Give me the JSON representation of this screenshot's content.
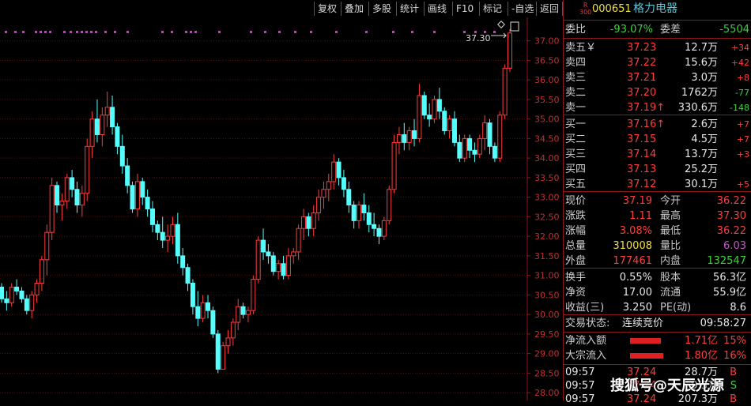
{
  "toolbar": {
    "buttons": [
      "复权",
      "叠加",
      "多股",
      "统计",
      "画线",
      "F10",
      "标记",
      "-自选",
      "返回"
    ]
  },
  "stock": {
    "badge_top": "R",
    "badge_bottom": "300",
    "code": "000651",
    "name": "格力电器"
  },
  "weibi": {
    "label1": "委比",
    "value1": "-93.07%",
    "label2": "委差",
    "value2": "-5504"
  },
  "sell": [
    {
      "label": "卖五￥",
      "price": "37.23",
      "vol": "12.7万",
      "chg": "+34"
    },
    {
      "label": "卖四",
      "price": "37.22",
      "vol": "15.6万",
      "chg": "+42"
    },
    {
      "label": "卖三",
      "price": "37.21",
      "vol": "3.0万",
      "chg": "+8"
    },
    {
      "label": "卖二",
      "price": "37.20",
      "vol": "1762万",
      "chg": "-77"
    },
    {
      "label": "卖一",
      "price": "37.19↑",
      "vol": "330.6万",
      "chg": "-148"
    }
  ],
  "buy": [
    {
      "label": "买一",
      "price": "37.16↑",
      "vol": "2.6万",
      "chg": "+7"
    },
    {
      "label": "买二",
      "price": "37.15",
      "vol": "4.5万",
      "chg": "+7"
    },
    {
      "label": "买三",
      "price": "37.14",
      "vol": "13.7万",
      "chg": "+3"
    },
    {
      "label": "买四",
      "price": "37.13",
      "vol": "25.2万",
      "chg": ""
    },
    {
      "label": "买五",
      "price": "37.12",
      "vol": "30.1万",
      "chg": "+5"
    }
  ],
  "quote": [
    {
      "l1": "现价",
      "v1": "37.19",
      "l2": "今开",
      "v2": "36.22"
    },
    {
      "l1": "涨跌",
      "v1": "1.11",
      "l2": "最高",
      "v2": "37.30"
    },
    {
      "l1": "涨幅",
      "v1": "3.08%",
      "l2": "最低",
      "v2": "36.22"
    },
    {
      "l1": "总量",
      "v1": "310008",
      "l2": "量比",
      "v2": "6.03"
    },
    {
      "l1": "外盘",
      "v1": "177461",
      "l2": "内盘",
      "v2": "132547"
    }
  ],
  "fund": [
    {
      "l1": "换手",
      "v1": "0.55%",
      "l2": "股本",
      "v2": "56.3亿"
    },
    {
      "l1": "净资",
      "v1": "17.00",
      "l2": "流通",
      "v2": "55.9亿"
    },
    {
      "l1": "收益(三)",
      "v1": "3.250",
      "l2": "PE(动)",
      "v2": "8.6"
    }
  ],
  "status": {
    "label": "交易状态:",
    "value": "连续竞价",
    "time": "09:58:27"
  },
  "flow": [
    {
      "label": "净流入额",
      "amount": "1.71亿",
      "pct": "15%",
      "bar": 0.15
    },
    {
      "label": "大宗流入",
      "amount": "1.80亿",
      "pct": "16%",
      "bar": 0.16
    }
  ],
  "ticks": [
    {
      "time": "09:57",
      "price": "37.24",
      "vol": "28.7万",
      "side": "B"
    },
    {
      "time": "09:57",
      "price": "37.24",
      "vol": "9.3万",
      "side": "S"
    },
    {
      "time": "09:57",
      "price": "37.24",
      "vol": "207.3万",
      "side": "B"
    }
  ],
  "annotation": {
    "price_label": "37.30"
  },
  "watermark": "搜狐号@天辰光源",
  "chart_data": {
    "type": "candlestick",
    "ylim": [
      27.8,
      37.6
    ],
    "yticks": [
      "37.00",
      "36.50",
      "36.00",
      "35.50",
      "35.00",
      "34.50",
      "34.00",
      "33.50",
      "33.00",
      "32.50",
      "32.00",
      "31.50",
      "31.00",
      "30.50",
      "30.00",
      "29.50",
      "29.00",
      "28.50",
      "28.00"
    ],
    "colors": {
      "up": "#ff3c3c",
      "down": "#54ffff"
    },
    "candles": [
      [
        30.7,
        30.8,
        30.3,
        30.4
      ],
      [
        30.4,
        30.6,
        30.1,
        30.3
      ],
      [
        30.3,
        30.8,
        30.2,
        30.7
      ],
      [
        30.7,
        30.9,
        30.5,
        30.6
      ],
      [
        30.6,
        30.7,
        30.3,
        30.4
      ],
      [
        30.4,
        30.5,
        30.0,
        30.1
      ],
      [
        30.1,
        30.6,
        29.9,
        30.5
      ],
      [
        30.5,
        30.9,
        30.3,
        30.8
      ],
      [
        30.8,
        31.5,
        30.6,
        31.4
      ],
      [
        31.4,
        32.3,
        31.0,
        32.1
      ],
      [
        32.1,
        33.5,
        31.9,
        33.3
      ],
      [
        33.3,
        33.4,
        32.6,
        32.8
      ],
      [
        32.8,
        33.1,
        32.4,
        32.9
      ],
      [
        32.9,
        33.6,
        32.7,
        33.5
      ],
      [
        33.5,
        33.7,
        33.0,
        33.2
      ],
      [
        33.2,
        33.4,
        32.6,
        32.8
      ],
      [
        32.8,
        33.3,
        32.5,
        33.1
      ],
      [
        33.1,
        34.5,
        32.9,
        34.3
      ],
      [
        34.3,
        35.2,
        34.0,
        35.0
      ],
      [
        35.0,
        35.5,
        34.4,
        34.6
      ],
      [
        34.6,
        35.3,
        34.3,
        35.1
      ],
      [
        35.1,
        35.7,
        34.8,
        35.3
      ],
      [
        35.3,
        35.6,
        34.6,
        34.8
      ],
      [
        34.8,
        34.9,
        34.1,
        34.3
      ],
      [
        34.3,
        34.6,
        33.6,
        33.8
      ],
      [
        33.8,
        34.0,
        33.1,
        33.3
      ],
      [
        33.3,
        33.4,
        32.6,
        32.7
      ],
      [
        32.7,
        33.6,
        32.5,
        33.4
      ],
      [
        33.4,
        33.5,
        32.8,
        33.0
      ],
      [
        33.0,
        33.2,
        32.5,
        32.7
      ],
      [
        32.7,
        32.9,
        32.1,
        32.3
      ],
      [
        32.3,
        32.4,
        31.9,
        32.1
      ],
      [
        32.1,
        32.5,
        31.7,
        31.9
      ],
      [
        31.9,
        32.3,
        31.6,
        32.0
      ],
      [
        32.0,
        32.5,
        31.8,
        32.3
      ],
      [
        32.3,
        32.6,
        31.3,
        31.5
      ],
      [
        31.5,
        31.7,
        31.0,
        31.2
      ],
      [
        31.2,
        31.3,
        30.6,
        30.8
      ],
      [
        30.8,
        30.9,
        30.0,
        30.2
      ],
      [
        30.2,
        30.6,
        29.7,
        29.9
      ],
      [
        29.9,
        30.5,
        29.8,
        30.3
      ],
      [
        30.3,
        30.5,
        29.9,
        30.1
      ],
      [
        30.1,
        30.2,
        29.4,
        29.5
      ],
      [
        29.5,
        29.6,
        28.5,
        28.6
      ],
      [
        28.6,
        29.3,
        28.6,
        29.2
      ],
      [
        29.2,
        29.6,
        29.0,
        29.4
      ],
      [
        29.4,
        29.9,
        29.2,
        29.8
      ],
      [
        29.8,
        30.4,
        29.6,
        30.2
      ],
      [
        30.2,
        30.3,
        29.9,
        30.0
      ],
      [
        30.0,
        30.2,
        29.8,
        30.1
      ],
      [
        30.1,
        31.0,
        30.0,
        30.9
      ],
      [
        30.9,
        32.0,
        30.8,
        31.9
      ],
      [
        31.9,
        32.2,
        31.4,
        31.6
      ],
      [
        31.6,
        31.8,
        31.3,
        31.5
      ],
      [
        31.5,
        31.6,
        31.0,
        31.1
      ],
      [
        31.1,
        31.4,
        30.9,
        31.3
      ],
      [
        31.3,
        31.5,
        30.9,
        31.0
      ],
      [
        31.0,
        31.7,
        30.9,
        31.5
      ],
      [
        31.5,
        31.7,
        31.3,
        31.6
      ],
      [
        31.6,
        32.3,
        31.4,
        32.2
      ],
      [
        32.2,
        32.7,
        31.9,
        32.5
      ],
      [
        32.5,
        32.6,
        32.0,
        32.2
      ],
      [
        32.2,
        32.8,
        32.0,
        32.6
      ],
      [
        32.6,
        33.2,
        32.4,
        33.0
      ],
      [
        33.0,
        33.4,
        32.7,
        33.2
      ],
      [
        33.2,
        33.6,
        32.9,
        33.4
      ],
      [
        33.4,
        34.1,
        33.2,
        33.9
      ],
      [
        33.9,
        34.0,
        33.3,
        33.5
      ],
      [
        33.5,
        33.7,
        33.0,
        33.2
      ],
      [
        33.2,
        33.4,
        32.6,
        32.8
      ],
      [
        32.8,
        32.9,
        32.2,
        32.4
      ],
      [
        32.4,
        32.9,
        32.2,
        32.8
      ],
      [
        32.8,
        33.1,
        32.4,
        32.6
      ],
      [
        32.6,
        32.8,
        32.1,
        32.3
      ],
      [
        32.3,
        32.6,
        32.0,
        32.2
      ],
      [
        32.2,
        32.3,
        31.8,
        32.0
      ],
      [
        32.0,
        32.5,
        31.9,
        32.4
      ],
      [
        32.4,
        33.3,
        32.3,
        33.2
      ],
      [
        33.2,
        34.6,
        33.1,
        34.4
      ],
      [
        34.4,
        34.8,
        34.1,
        34.6
      ],
      [
        34.6,
        34.9,
        34.2,
        34.4
      ],
      [
        34.4,
        34.8,
        34.2,
        34.7
      ],
      [
        34.7,
        35.0,
        34.3,
        34.5
      ],
      [
        34.5,
        35.9,
        34.4,
        35.6
      ],
      [
        35.6,
        35.7,
        35.0,
        35.1
      ],
      [
        35.1,
        35.4,
        34.8,
        35.0
      ],
      [
        35.0,
        35.6,
        34.9,
        35.5
      ],
      [
        35.5,
        35.8,
        35.0,
        35.2
      ],
      [
        35.2,
        35.3,
        34.6,
        34.7
      ],
      [
        34.7,
        35.1,
        34.5,
        35.0
      ],
      [
        35.0,
        35.2,
        34.3,
        34.4
      ],
      [
        34.4,
        34.6,
        33.9,
        34.0
      ],
      [
        34.0,
        34.6,
        33.9,
        34.5
      ],
      [
        34.5,
        34.6,
        34.0,
        34.2
      ],
      [
        34.2,
        34.4,
        33.9,
        34.1
      ],
      [
        34.1,
        34.6,
        34.0,
        34.5
      ],
      [
        34.5,
        35.1,
        34.2,
        34.9
      ],
      [
        34.9,
        35.0,
        34.1,
        34.3
      ],
      [
        34.3,
        34.4,
        33.9,
        34.0
      ],
      [
        34.0,
        35.2,
        33.9,
        35.1
      ],
      [
        35.1,
        36.4,
        35.0,
        36.3
      ],
      [
        36.3,
        37.3,
        36.2,
        37.2
      ]
    ]
  }
}
